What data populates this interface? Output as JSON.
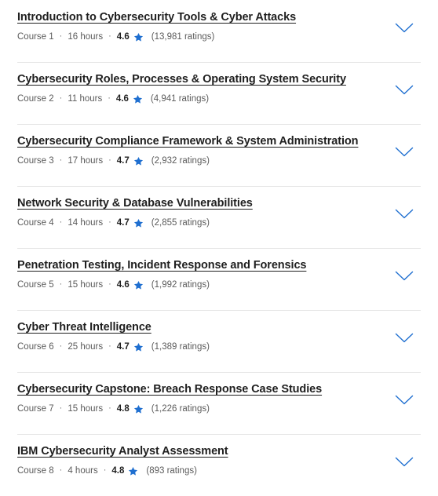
{
  "colors": {
    "accent_blue": "#1f6fd0",
    "star_blue": "#1f6fd0",
    "title_text": "#1f1f1f",
    "meta_text": "#5b5b5b",
    "divider": "#e5e5e5",
    "background": "#ffffff"
  },
  "icons": {
    "star": "star-icon",
    "expand": "chevron-down-icon"
  },
  "separator": "·",
  "courses": [
    {
      "title": "Introduction to Cybersecurity Tools & Cyber Attacks",
      "course_number": "Course 1",
      "duration": "16 hours",
      "rating": "4.6",
      "ratings_count": "(13,981 ratings)"
    },
    {
      "title": "Cybersecurity Roles, Processes & Operating System Security",
      "course_number": "Course 2",
      "duration": "11 hours",
      "rating": "4.6",
      "ratings_count": "(4,941 ratings)"
    },
    {
      "title": "Cybersecurity Compliance Framework & System Administration",
      "course_number": "Course 3",
      "duration": "17 hours",
      "rating": "4.7",
      "ratings_count": "(2,932 ratings)"
    },
    {
      "title": "Network Security & Database Vulnerabilities",
      "course_number": "Course 4",
      "duration": "14 hours",
      "rating": "4.7",
      "ratings_count": "(2,855 ratings)"
    },
    {
      "title": "Penetration Testing, Incident Response and Forensics",
      "course_number": "Course 5",
      "duration": "15 hours",
      "rating": "4.6",
      "ratings_count": "(1,992 ratings)"
    },
    {
      "title": "Cyber Threat Intelligence",
      "course_number": "Course 6",
      "duration": "25 hours",
      "rating": "4.7",
      "ratings_count": "(1,389 ratings)"
    },
    {
      "title": "Cybersecurity Capstone: Breach Response Case Studies",
      "course_number": "Course 7",
      "duration": "15 hours",
      "rating": "4.8",
      "ratings_count": "(1,226 ratings)"
    },
    {
      "title": "IBM Cybersecurity Analyst Assessment",
      "course_number": "Course 8",
      "duration": "4 hours",
      "rating": "4.8",
      "ratings_count": "(893 ratings)"
    }
  ]
}
